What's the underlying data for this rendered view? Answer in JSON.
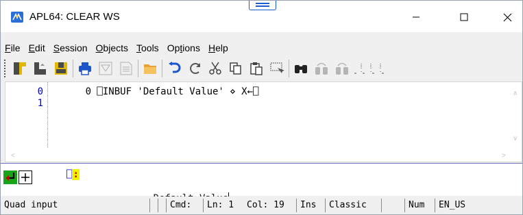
{
  "window": {
    "title": "APL64: CLEAR WS",
    "controls": {
      "minimize": "minimize",
      "maximize": "maximize",
      "close": "close"
    }
  },
  "menu": [
    {
      "pre": "",
      "u": "F",
      "post": "ile"
    },
    {
      "pre": "",
      "u": "E",
      "post": "dit"
    },
    {
      "pre": "",
      "u": "S",
      "post": "ession"
    },
    {
      "pre": "",
      "u": "O",
      "post": "bjects"
    },
    {
      "pre": "",
      "u": "T",
      "post": "ools"
    },
    {
      "pre": "Op",
      "u": "t",
      "post": "ions"
    },
    {
      "pre": "",
      "u": "H",
      "post": "elp"
    }
  ],
  "toolbar": {
    "icons": [
      "new-session-icon",
      "load-icon",
      "save-icon",
      "print-icon",
      "filter-icon",
      "document-icon",
      "folder-icon",
      "undo-icon",
      "redo-icon",
      "cut-icon",
      "copy-icon",
      "paste-icon",
      "select-icon",
      "find-icon",
      "find-prev-icon",
      "find-next-icon"
    ]
  },
  "session": {
    "lines": [
      {
        "number": "0",
        "text": "      0 ⎕INBUF 'Default Value' ⋄ X←⎕"
      },
      {
        "number": "1",
        "text": ""
      }
    ]
  },
  "quad": {
    "prompt_symbol": "⎕",
    "prompt_colon": ":",
    "input_value": "Default Value"
  },
  "status": {
    "mode": "Quad input",
    "blank1": "",
    "blank2": "",
    "cmd": "Cmd:",
    "line": "Ln: 1",
    "col": "Col: 19",
    "ins": "Ins",
    "keyboard": "Classic",
    "blank3": "",
    "num": "Num",
    "locale": "EN_US"
  },
  "colors": {
    "accent_blue": "#1a5bd0",
    "line_number": "#0000cc",
    "prompt_highlight": "#f2f200"
  }
}
